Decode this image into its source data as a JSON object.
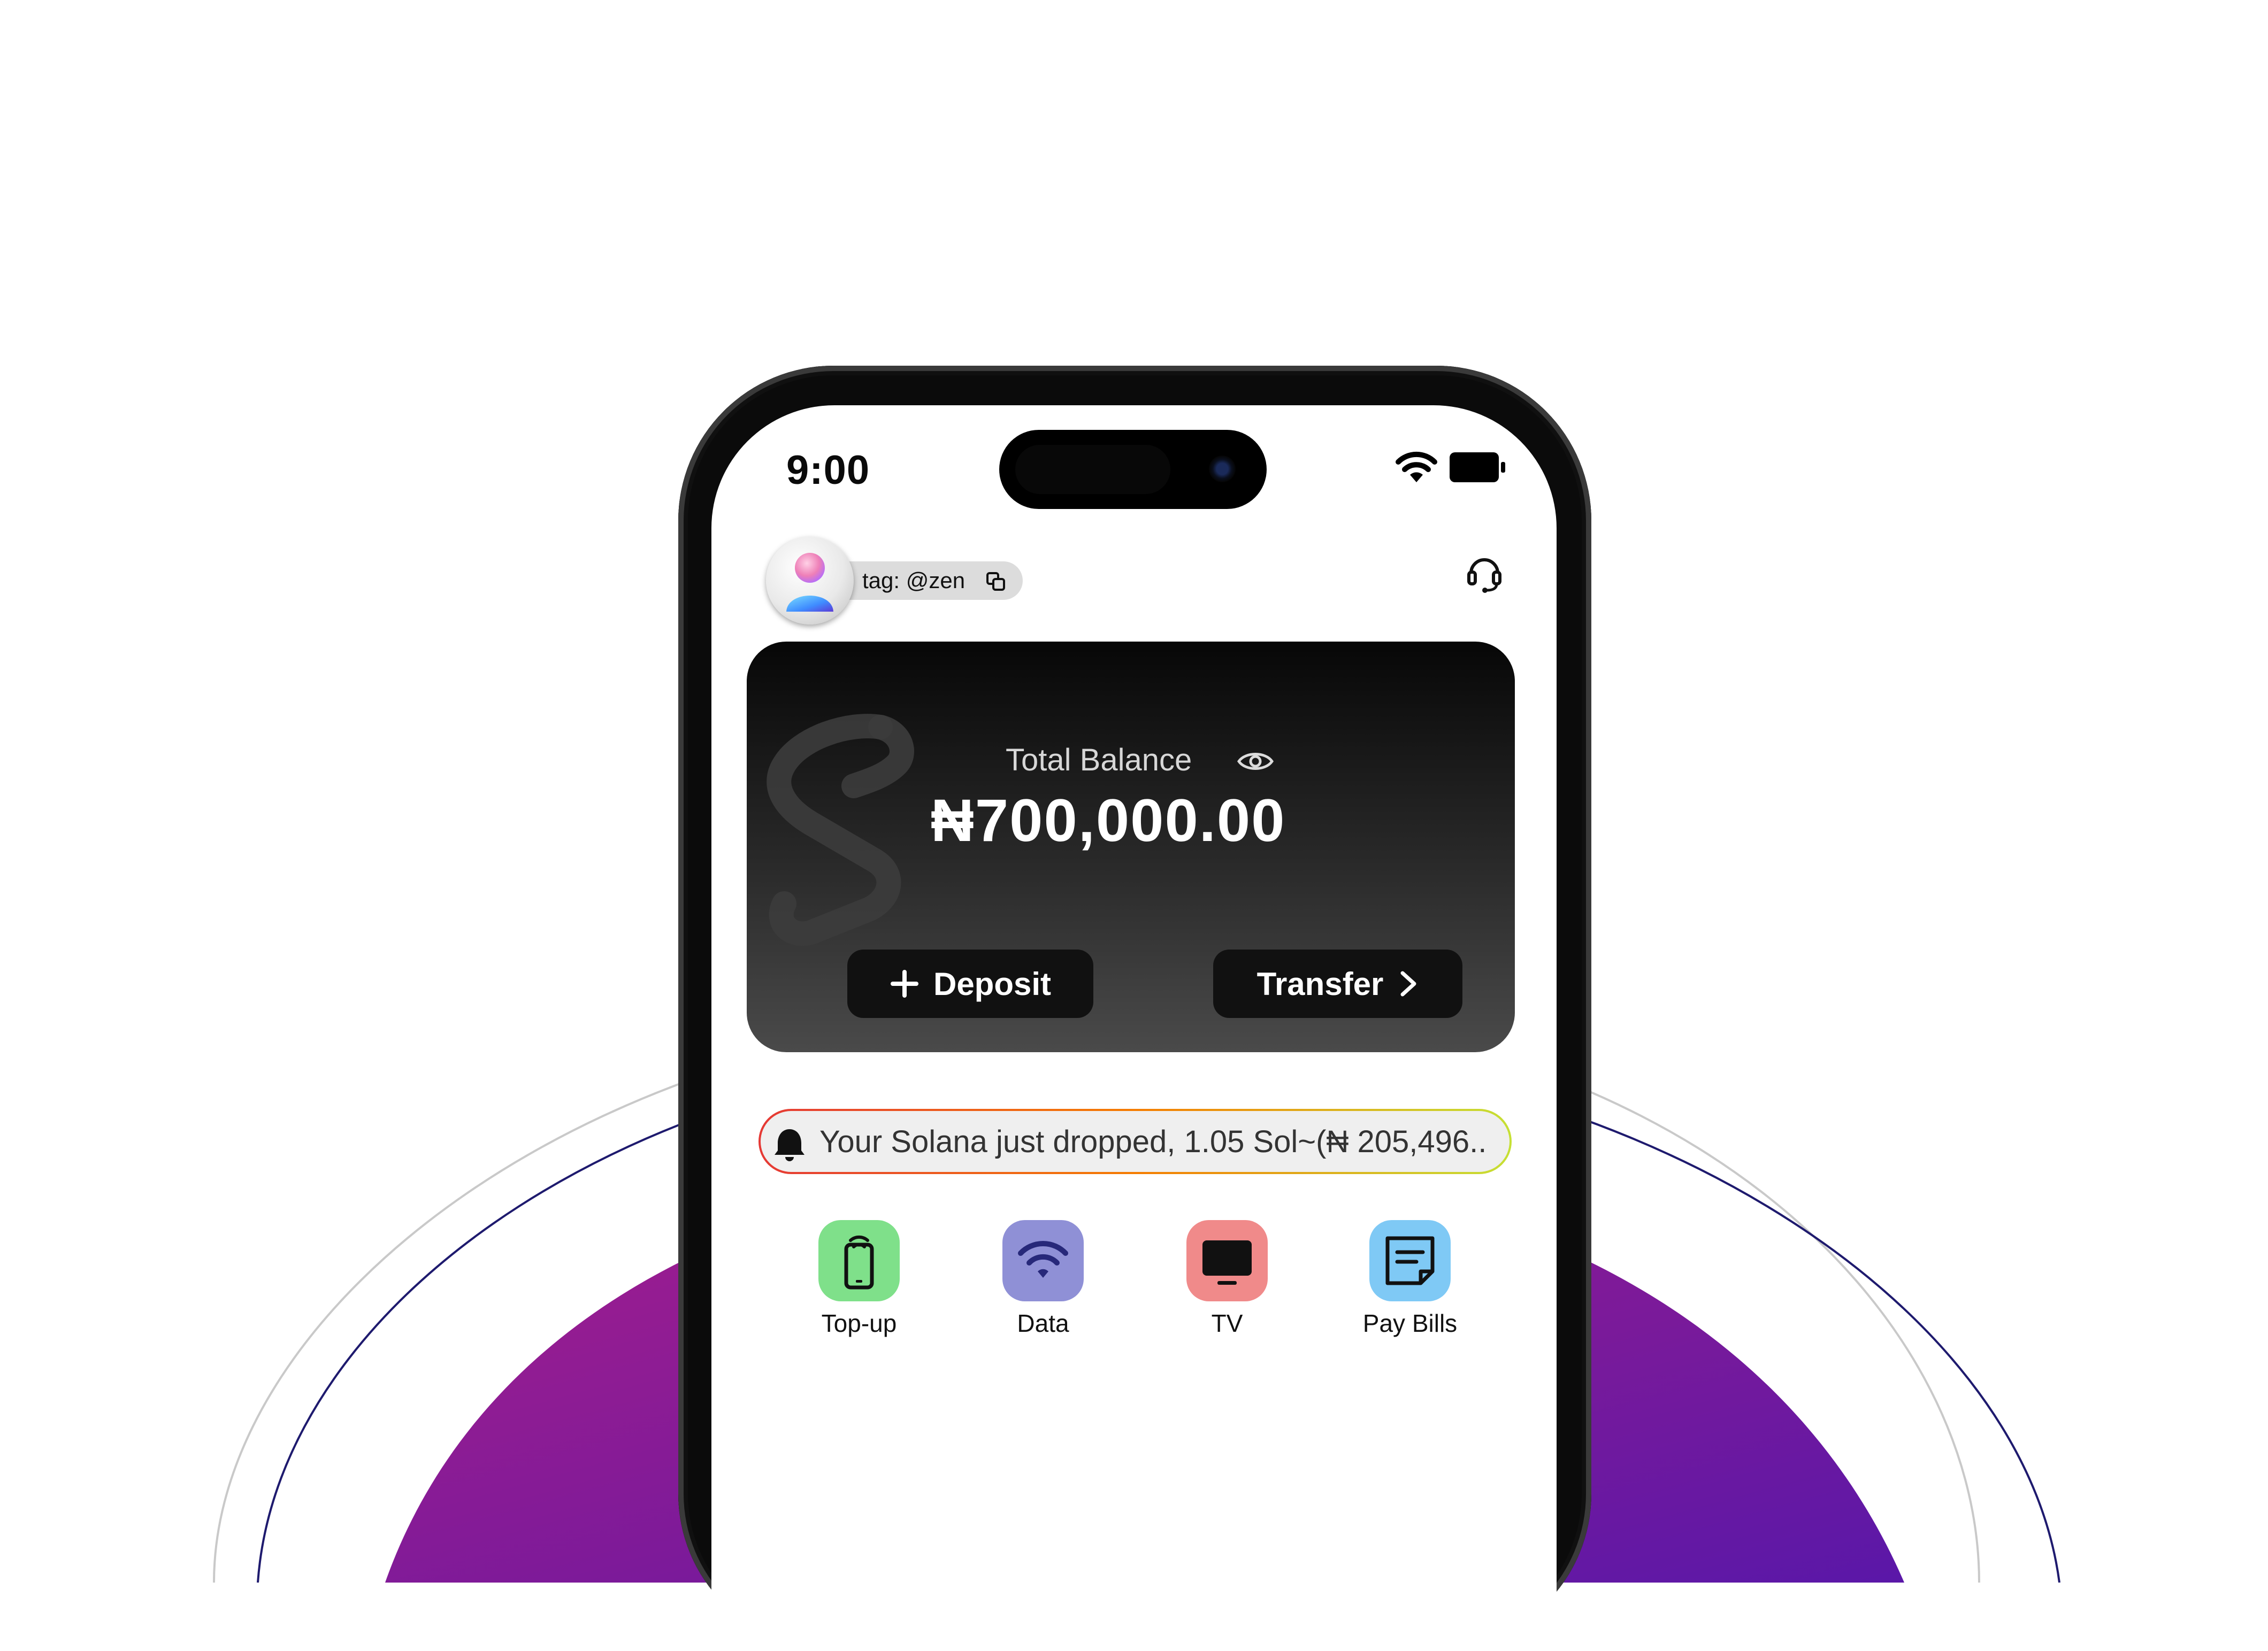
{
  "status_bar": {
    "time": "9:00",
    "wifi_icon": "wifi-icon",
    "battery_icon": "battery-icon"
  },
  "header": {
    "tag_text": "tag: @zen",
    "copy_icon": "copy-icon",
    "support_icon": "headset-icon"
  },
  "balance_card": {
    "label": "Total Balance",
    "eye_icon": "eye-icon",
    "amount": "₦700,000.00",
    "deposit_label": "Deposit",
    "transfer_label": "Transfer"
  },
  "notification": {
    "bell_icon": "bell-icon",
    "text": "Your Solana just dropped, 1.05 Sol~(₦ 205,496.."
  },
  "services": [
    {
      "label": "Top-up",
      "icon": "phone-topup-icon",
      "color": "#7fe08a"
    },
    {
      "label": "Data",
      "icon": "wifi-icon",
      "color": "#8f90d6"
    },
    {
      "label": "TV",
      "icon": "tv-icon",
      "color": "#f08a8a"
    },
    {
      "label": "Pay Bills",
      "icon": "bills-icon",
      "color": "#7fc9f5"
    }
  ],
  "colors": {
    "accent_purple": "#8a1f9a",
    "accent_violet": "#5b1aa8",
    "card_dark": "#111111"
  }
}
